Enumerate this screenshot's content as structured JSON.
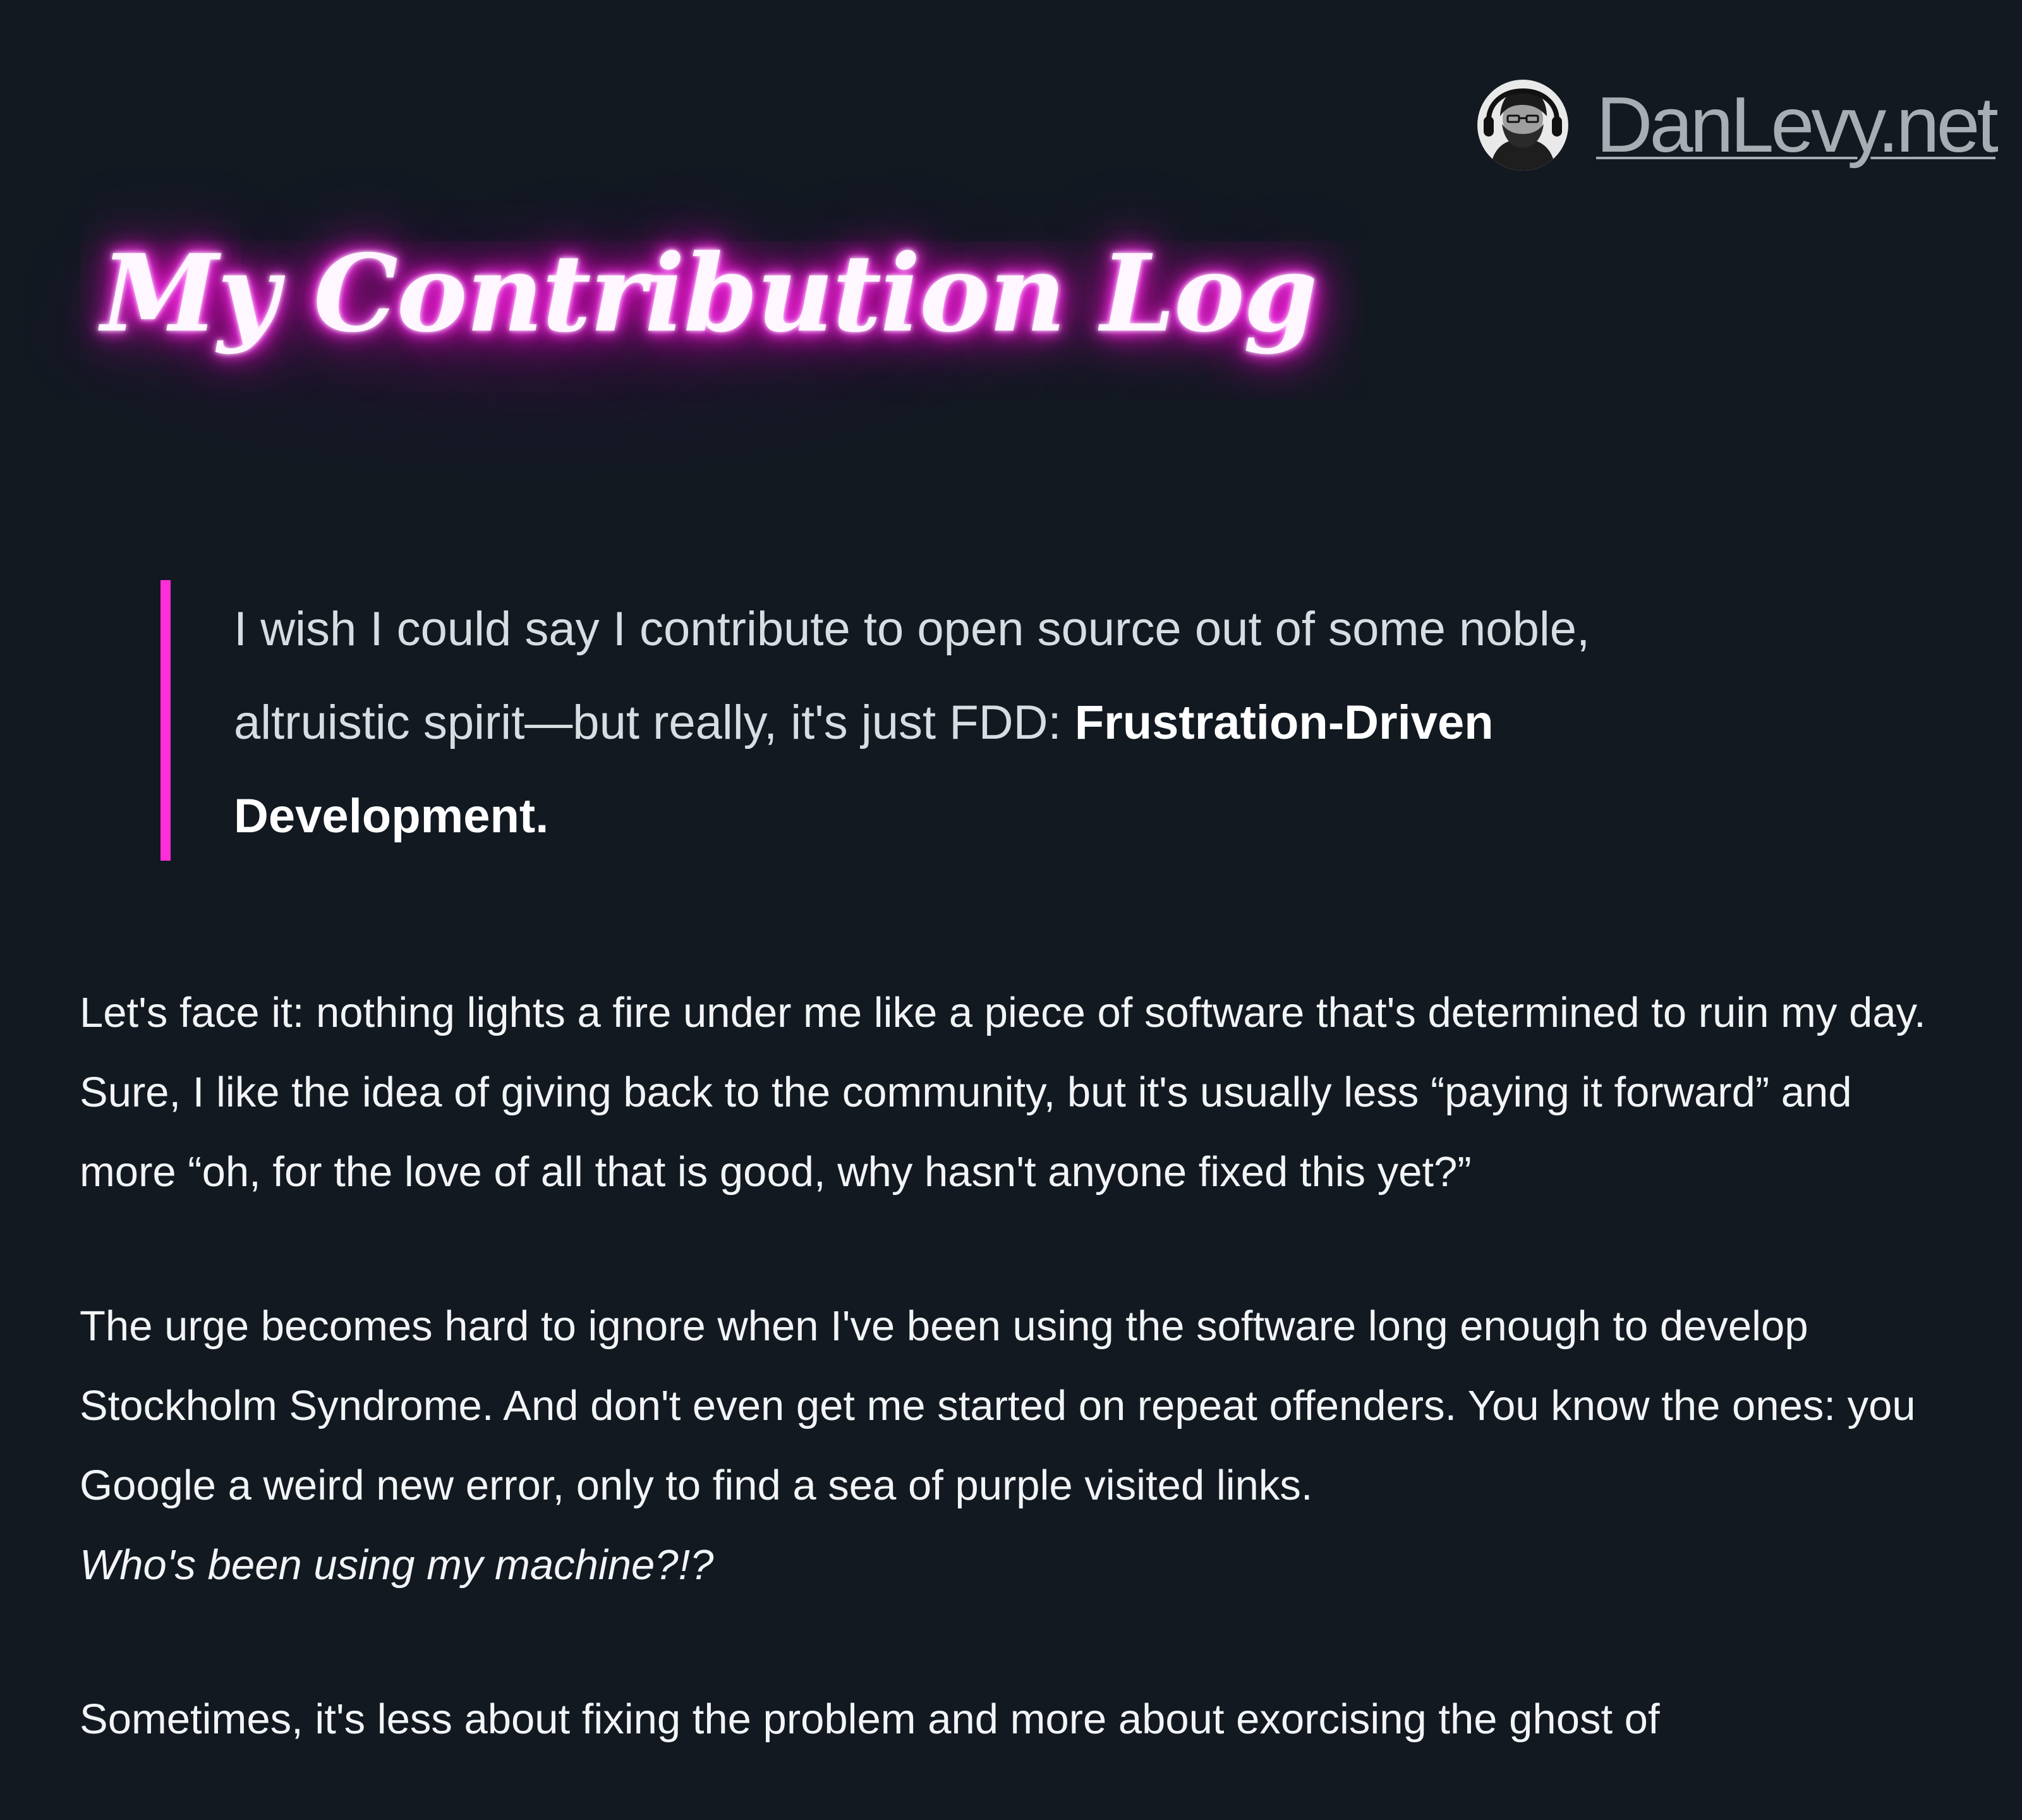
{
  "header": {
    "brand": "DanLevy.net",
    "avatar_alt": "avatar"
  },
  "title": "My Contribution Log",
  "quote": {
    "text": "I wish I could say I contribute to open source out of some noble, altruistic spirit—but really, it's just FDD: ",
    "emphasis": "Frustration-Driven Development."
  },
  "article": {
    "paragraphs": [
      "Let's face it: nothing lights a fire under me like a piece of software that's determined to ruin my day. Sure, I like the idea of giving back to the community, but it's usually less “paying it forward” and more “oh, for the love of all that is good, why hasn't anyone fixed this yet?”",
      "The urge becomes hard to ignore when I've been using the software long enough to develop Stockholm Syndrome. And don't even get me started on repeat offenders. You know the ones: you Google a weird new error, only to find a sea of purple visited links.",
      "Sometimes, it's less about fixing the problem and more about exorcising the ghost of"
    ],
    "italic_line": "Who's been using my machine?!?"
  },
  "colors": {
    "background": "#121921",
    "accent": "#ff2ed8",
    "neon": "#ff00cc",
    "brand": "#a8adb3"
  },
  "icons": {
    "avatar": "person-avatar-icon"
  }
}
